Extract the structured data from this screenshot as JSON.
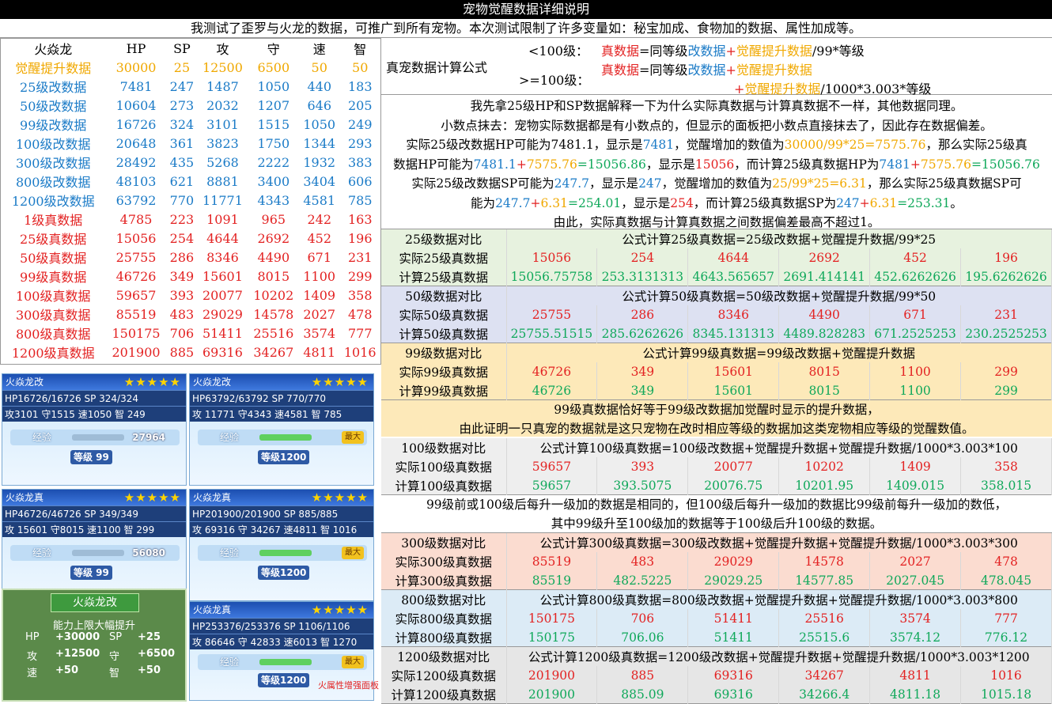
{
  "title": "宠物觉醒数据详细说明",
  "notice": "我测试了歪罗与火龙的数据，可推广到所有宠物。本次测试限制了许多变量如：秘宝加成、食物加的数据、属性加成等。",
  "left_table": {
    "header": [
      "火焱龙",
      "HP",
      "SP",
      "攻",
      "守",
      "速",
      "智"
    ],
    "rows": [
      {
        "label": "觉醒提升数据",
        "color": "orange",
        "values": [
          "30000",
          "25",
          "12500",
          "6500",
          "50",
          "50"
        ]
      },
      {
        "label": "25级改数据",
        "color": "blue",
        "values": [
          "7481",
          "247",
          "1487",
          "1050",
          "440",
          "183"
        ]
      },
      {
        "label": "50级改数据",
        "color": "blue",
        "values": [
          "10604",
          "273",
          "2032",
          "1207",
          "646",
          "205"
        ]
      },
      {
        "label": "99级改数据",
        "color": "blue",
        "values": [
          "16726",
          "324",
          "3101",
          "1515",
          "1050",
          "249"
        ]
      },
      {
        "label": "100级改数据",
        "color": "blue",
        "values": [
          "20648",
          "361",
          "3823",
          "1750",
          "1344",
          "293"
        ]
      },
      {
        "label": "300级改数据",
        "color": "blue",
        "values": [
          "28492",
          "435",
          "5268",
          "2222",
          "1932",
          "383"
        ]
      },
      {
        "label": "800级改数据",
        "color": "blue",
        "values": [
          "48103",
          "621",
          "8881",
          "3400",
          "3404",
          "606"
        ]
      },
      {
        "label": "1200级改数据",
        "color": "blue",
        "values": [
          "63792",
          "770",
          "11771",
          "4343",
          "4581",
          "785"
        ]
      },
      {
        "label": "1级真数据",
        "color": "red",
        "values": [
          "4785",
          "223",
          "1091",
          "965",
          "242",
          "163"
        ]
      },
      {
        "label": "25级真数据",
        "color": "red",
        "values": [
          "15056",
          "254",
          "4644",
          "2692",
          "452",
          "196"
        ]
      },
      {
        "label": "50级真数据",
        "color": "red",
        "values": [
          "25755",
          "286",
          "8346",
          "4490",
          "671",
          "231"
        ]
      },
      {
        "label": "99级真数据",
        "color": "red",
        "values": [
          "46726",
          "349",
          "15601",
          "8015",
          "1100",
          "299"
        ]
      },
      {
        "label": "100级真数据",
        "color": "red",
        "values": [
          "59657",
          "393",
          "20077",
          "10202",
          "1409",
          "358"
        ]
      },
      {
        "label": "300级真数据",
        "color": "red",
        "values": [
          "85519",
          "483",
          "29029",
          "14578",
          "2027",
          "478"
        ]
      },
      {
        "label": "800级真数据",
        "color": "red",
        "values": [
          "150175",
          "706",
          "51411",
          "25516",
          "3574",
          "777"
        ]
      },
      {
        "label": "1200级真数据",
        "color": "red",
        "values": [
          "201900",
          "885",
          "69316",
          "34267",
          "4811",
          "1016"
        ]
      }
    ]
  },
  "formula": {
    "label": "真宠数据计算公式",
    "lt100": "<100级：",
    "ge100": ">=100级：",
    "f1_a": "真数据",
    "f1_b": "=同等级",
    "f1_c": "改数据",
    "f1_d": "+",
    "f1_e": "觉醒提升数据",
    "f1_f": "/99*等级",
    "f2_a": "真数据",
    "f2_b": "=同等级",
    "f2_c": "改数据",
    "f2_d": "+",
    "f2_e": "觉醒提升数据",
    "f3_a": "+",
    "f3_b": "觉醒提升数据",
    "f3_c": "/1000*3.003*等级"
  },
  "explain": {
    "l1": "我先拿25级HP和SP数据解释一下为什么实际真数据与计算真数据不一样，其他数据同理。",
    "l2": "小数点抹去：宠物实际数据都是有小数点的，但显示的面板把小数点直接抹去了，因此存在数据偏差。",
    "l3a": "实际25级改数据HP可能为7481.1，显示是",
    "l3b": "7481",
    "l3c": "，觉醒增加的数值为",
    "l3d": "30000/99*25=7575.76",
    "l3e": "，那么实际25级真",
    "l4a": "数据HP可能为",
    "l4b": "7481.1",
    "l4c": "+",
    "l4d": "7575.76",
    "l4e": "=15056.86",
    "l4f": "，显示是",
    "l4g": "15056",
    "l4h": "，而计算25级真数据HP为",
    "l4i": "7481",
    "l4j": "+",
    "l4k": "7575.76",
    "l4l": "=15056.76",
    "l5a": "实际25级改数据SP可能为",
    "l5b": "247.7",
    "l5c": "，显示是",
    "l5d": "247",
    "l5e": "，觉醒增加的数值为",
    "l5f": "25/99*25=6.31",
    "l5g": "，那么实际25级真数据SP可",
    "l6a": "能为",
    "l6b": "247.7",
    "l6c": "+",
    "l6d": "6.31",
    "l6e": "=254.01",
    "l6f": "，显示是",
    "l6g": "254",
    "l6h": "，而计算25级真数据SP为",
    "l6i": "247",
    "l6j": "+",
    "l6k": "6.31",
    "l6l": "=253.31",
    "l6m": "。",
    "l7": "由此，实际真数据与计算真数据之间数据偏差最高不超过1。"
  },
  "blocks": [
    {
      "id": "c25",
      "title": "25级数据对比",
      "formula": "公式计算25级真数据=25级改数据+觉醒提升数据/99*25",
      "actual_label": "实际25级真数据",
      "actual": [
        "15056",
        "254",
        "4644",
        "2692",
        "452",
        "196"
      ],
      "calc_label": "计算25级真数据",
      "calc": [
        "15056.75758",
        "253.3131313",
        "4643.565657",
        "2691.414141",
        "452.6262626",
        "195.6262626"
      ]
    },
    {
      "id": "c50",
      "title": "50级数据对比",
      "formula": "公式计算50级真数据=50级改数据+觉醒提升数据/99*50",
      "actual_label": "实际50级真数据",
      "actual": [
        "25755",
        "286",
        "8346",
        "4490",
        "671",
        "231"
      ],
      "calc_label": "计算50级真数据",
      "calc": [
        "25755.51515",
        "285.6262626",
        "8345.131313",
        "4489.828283",
        "671.2525253",
        "230.2525253"
      ]
    },
    {
      "id": "c99",
      "title": "99级数据对比",
      "formula": "公式计算99级真数据=99级改数据+觉醒提升数据",
      "actual_label": "实际99级真数据",
      "actual": [
        "46726",
        "349",
        "15601",
        "8015",
        "1100",
        "299"
      ],
      "calc_label": "计算99级真数据",
      "calc": [
        "46726",
        "349",
        "15601",
        "8015",
        "1100",
        "299"
      ]
    },
    {
      "id": "c100",
      "title": "100级数据对比",
      "formula": "公式计算100级真数据=100级改数据+觉醒提升数据+觉醒提升数据/1000*3.003*100",
      "actual_label": "实际100级真数据",
      "actual": [
        "59657",
        "393",
        "20077",
        "10202",
        "1409",
        "358"
      ],
      "calc_label": "计算100级真数据",
      "calc": [
        "59657",
        "393.5075",
        "20076.75",
        "10201.95",
        "1409.015",
        "358.015"
      ]
    },
    {
      "id": "c300",
      "title": "300级数据对比",
      "formula": "公式计算300级真数据=300级改数据+觉醒提升数据+觉醒提升数据/1000*3.003*300",
      "actual_label": "实际300级真数据",
      "actual": [
        "85519",
        "483",
        "29029",
        "14578",
        "2027",
        "478"
      ],
      "calc_label": "计算300级真数据",
      "calc": [
        "85519",
        "482.5225",
        "29029.25",
        "14577.85",
        "2027.045",
        "478.045"
      ]
    },
    {
      "id": "c800",
      "title": "800级数据对比",
      "formula": "公式计算800级真数据=800级改数据+觉醒提升数据+觉醒提升数据/1000*3.003*800",
      "actual_label": "实际800级真数据",
      "actual": [
        "150175",
        "706",
        "51411",
        "25516",
        "3574",
        "777"
      ],
      "calc_label": "计算800级真数据",
      "calc": [
        "150175",
        "706.06",
        "51411",
        "25515.6",
        "3574.12",
        "776.12"
      ]
    },
    {
      "id": "c1200",
      "title": "1200级数据对比",
      "formula": "公式计算1200级真数据=1200级改数据+觉醒提升数据+觉醒提升数据/1000*3.003*1200",
      "actual_label": "实际1200级真数据",
      "actual": [
        "201900",
        "885",
        "69316",
        "34267",
        "4811",
        "1016"
      ],
      "calc_label": "计算1200级真数据",
      "calc": [
        "201900",
        "885.09",
        "69316",
        "34266.4",
        "4811.18",
        "1015.18"
      ]
    }
  ],
  "note99": {
    "l1": "99级真数据恰好等于99级改数据加觉醒时显示的提升数据，",
    "l2": "由此证明一只真宠的数据就是这只宠物在改时相应等级的数据加这类宠物相应等级的觉醒数值。"
  },
  "note100": {
    "l1": "99级前或100级后每升一级加的数据是相同的，但100级后每升一级加的数据比99级前每升一级加的数低，",
    "l2": "其中99级升至100级加的数据等于100级后升100级的数据。"
  },
  "panels": [
    {
      "name": "火焱龙改",
      "stars": "★★★★★",
      "hp": "HP16726/16726",
      "sp": "SP 324/324",
      "stats": "攻3101 守1515 速1050 智 249",
      "exp_label": "经验",
      "exp": "27964",
      "exp_fill": 0,
      "max": "",
      "lv": "等级 99"
    },
    {
      "name": "火焱龙改",
      "stars": "★★★★★",
      "hp": "HP63792/63792",
      "sp": "SP 770/770",
      "stats": "攻 11771 守4343 速4581 智 785",
      "exp_label": "经验",
      "exp": "",
      "exp_fill": 1,
      "max": "最大",
      "lv": "等级1200"
    },
    {
      "name": "火焱龙真",
      "stars": "★★★★★",
      "hp": "HP46726/46726",
      "sp": "SP 349/349",
      "stats": "攻 15601 守8015 速1100 智 299",
      "exp_label": "经验",
      "exp": "56080",
      "exp_fill": 0,
      "max": "",
      "lv": "等级 99"
    },
    {
      "name": "火焱龙真",
      "stars": "★★★★★",
      "hp": "HP201900/201900",
      "sp": "SP 885/885",
      "stats": "攻 69316 守 34267 速4811 智 1016",
      "exp_label": "经验",
      "exp": "",
      "exp_fill": 1,
      "max": "最大",
      "lv": "等级1200"
    },
    {
      "name": "火焱龙真",
      "stars": "★★★★★",
      "hp": "HP253376/253376",
      "sp": "SP 1106/1106",
      "stats": "攻 86646 守 42833 速6013 智 1270",
      "exp_label": "经验",
      "exp": "",
      "exp_fill": 1,
      "max": "最大",
      "lv": "等级1200"
    }
  ],
  "awaken": {
    "title": "火焱龙改",
    "subtitle": "能力上限大幅提升",
    "hp_k": "HP",
    "hp_v": "+30000",
    "sp_k": "SP",
    "sp_v": "+25",
    "atk_k": "攻",
    "atk_v": "+12500",
    "def_k": "守",
    "def_v": "+6500",
    "spd_k": "速",
    "spd_v": "+50",
    "int_k": "智",
    "int_v": "+50"
  },
  "fire_tag": "火属性增强面板"
}
